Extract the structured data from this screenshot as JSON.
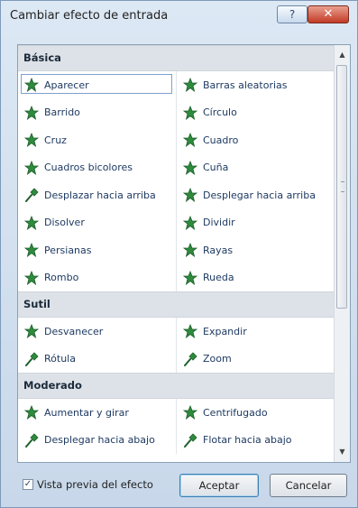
{
  "dialog": {
    "title": "Cambiar efecto de entrada",
    "help_label": "?",
    "close_label": "✕"
  },
  "categories": [
    {
      "label": "Básica",
      "items": [
        {
          "label": "Aparecer",
          "icon": "star-appear-icon",
          "selected": true
        },
        {
          "label": "Barras aleatorias",
          "icon": "star-random-bars-icon"
        },
        {
          "label": "Barrido",
          "icon": "star-wipe-icon"
        },
        {
          "label": "Círculo",
          "icon": "star-circle-icon"
        },
        {
          "label": "Cruz",
          "icon": "star-plus-icon"
        },
        {
          "label": "Cuadro",
          "icon": "star-box-icon"
        },
        {
          "label": "Cuadros bicolores",
          "icon": "star-checkerboard-icon"
        },
        {
          "label": "Cuña",
          "icon": "star-wedge-icon"
        },
        {
          "label": "Desplazar hacia arriba",
          "icon": "pin-crawl-in-icon"
        },
        {
          "label": "Desplegar hacia arriba",
          "icon": "star-peek-in-icon"
        },
        {
          "label": "Disolver",
          "icon": "star-dissolve-icon"
        },
        {
          "label": "Dividir",
          "icon": "star-split-icon"
        },
        {
          "label": "Persianas",
          "icon": "star-blinds-icon"
        },
        {
          "label": "Rayas",
          "icon": "star-strips-icon"
        },
        {
          "label": "Rombo",
          "icon": "star-diamond-icon"
        },
        {
          "label": "Rueda",
          "icon": "star-wheel-icon"
        }
      ]
    },
    {
      "label": "Sutil",
      "items": [
        {
          "label": "Desvanecer",
          "icon": "star-fade-icon"
        },
        {
          "label": "Expandir",
          "icon": "star-expand-icon"
        },
        {
          "label": "Rótula",
          "icon": "pin-swivel-icon"
        },
        {
          "label": "Zoom",
          "icon": "pin-zoom-icon"
        }
      ]
    },
    {
      "label": "Moderado",
      "items": [
        {
          "label": "Aumentar y girar",
          "icon": "star-grow-turn-icon"
        },
        {
          "label": "Centrifugado",
          "icon": "star-spinner-icon"
        },
        {
          "label": "Desplegar hacia abajo",
          "icon": "pin-unfold-icon"
        },
        {
          "label": "Flotar hacia abajo",
          "icon": "pin-float-down-icon"
        }
      ]
    }
  ],
  "footer": {
    "preview_label": "Vista previa del efecto",
    "preview_checked": true,
    "accept_label": "Aceptar",
    "cancel_label": "Cancelar"
  },
  "colors": {
    "icon_green": "#2e8b3d",
    "icon_dark": "#1d5f2a",
    "link_text": "#1e3a62",
    "category_bg": "#dde2e8"
  }
}
